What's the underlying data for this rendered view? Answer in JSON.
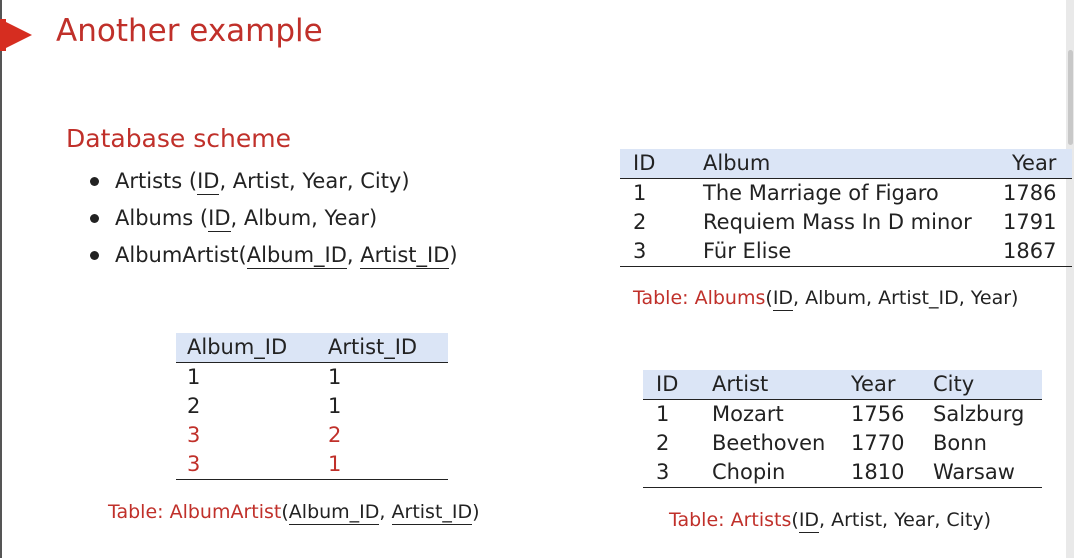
{
  "slide": {
    "title": "Another example",
    "section_title": "Database scheme",
    "scheme": [
      {
        "name": "Artists",
        "open": " (",
        "key": "ID",
        "rest": ", Artist, Year, City)"
      },
      {
        "name": "Albums",
        "open": " (",
        "key": "ID",
        "rest": ", Album, Year)"
      },
      {
        "name": "AlbumArtist",
        "open": "(",
        "key1": "Album_ID",
        "sep": ", ",
        "key2": "Artist_ID",
        "close": ")"
      }
    ]
  },
  "albums_table": {
    "headers": [
      "ID",
      "Album",
      "Year"
    ],
    "rows": [
      [
        "1",
        "The Marriage of Figaro",
        "1786"
      ],
      [
        "2",
        "Requiem Mass In D minor",
        "1791"
      ],
      [
        "3",
        "Für Elise",
        "1867"
      ]
    ],
    "caption": {
      "label": "Table:",
      "name": "Albums",
      "open": "(",
      "key": "ID",
      "rest": ", Album, Artist_ID, Year)"
    }
  },
  "albumartist_table": {
    "headers": [
      "Album_ID",
      "Artist_ID"
    ],
    "rows": [
      [
        "1",
        "1"
      ],
      [
        "2",
        "1"
      ],
      [
        "3",
        "2"
      ],
      [
        "3",
        "1"
      ]
    ],
    "highlight_color": "#c0302a",
    "caption": {
      "label": "Table:",
      "name": "AlbumArtist",
      "open": "(",
      "key1": "Album_ID",
      "sep": ", ",
      "key2": "Artist_ID",
      "close": ")"
    }
  },
  "artists_table": {
    "headers": [
      "ID",
      "Artist",
      "Year",
      "City"
    ],
    "rows": [
      [
        "1",
        "Mozart",
        "1756",
        "Salzburg"
      ],
      [
        "2",
        "Beethoven",
        "1770",
        "Bonn"
      ],
      [
        "3",
        "Chopin",
        "1810",
        "Warsaw"
      ]
    ],
    "caption": {
      "label": "Table:",
      "name": "Artists",
      "open": "(",
      "key": "ID",
      "rest": ", Artist, Year, City)"
    }
  },
  "colors": {
    "accent": "#c0302a",
    "header_bg": "#dbe5f6",
    "marker": "#d62d20"
  }
}
